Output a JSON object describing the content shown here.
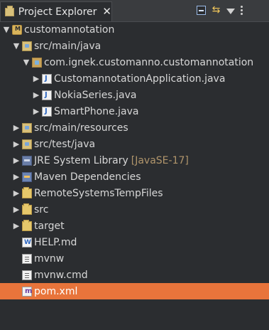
{
  "tab": {
    "title": "Project Explorer",
    "close": "✕"
  },
  "toolbar": {
    "collapse_all": "collapse-all",
    "link_with_editor": "link-with-editor",
    "filter": "filter",
    "view_menu": "view-menu"
  },
  "tree": {
    "items": [
      {
        "label": "customannotation",
        "icon": "project-icon",
        "expanded": true
      },
      {
        "label": "src/main/java",
        "icon": "source-folder-icon",
        "expanded": true
      },
      {
        "label": "com.ignek.customanno.customannotation",
        "icon": "package-icon",
        "expanded": true
      },
      {
        "label": "CustomannotationApplication.java",
        "icon": "java-class-icon",
        "expanded": false
      },
      {
        "label": "NokiaSeries.java",
        "icon": "java-interface-icon",
        "expanded": false
      },
      {
        "label": "SmartPhone.java",
        "icon": "java-class-icon",
        "expanded": false
      },
      {
        "label": "src/main/resources",
        "icon": "source-folder-icon",
        "expanded": false
      },
      {
        "label": "src/test/java",
        "icon": "source-folder-icon",
        "expanded": false
      },
      {
        "label": "JRE System Library",
        "extra": "[JavaSE-17]",
        "icon": "library-icon",
        "expanded": false
      },
      {
        "label": "Maven Dependencies",
        "icon": "maven-icon",
        "expanded": false
      },
      {
        "label": "RemoteSystemsTempFiles",
        "icon": "folder-icon",
        "expanded": false
      },
      {
        "label": "src",
        "icon": "folder-icon",
        "expanded": false
      },
      {
        "label": "target",
        "icon": "folder-icon",
        "expanded": false
      },
      {
        "label": "HELP.md",
        "icon": "markdown-file-icon"
      },
      {
        "label": "mvnw",
        "icon": "file-icon"
      },
      {
        "label": "mvnw.cmd",
        "icon": "file-icon"
      },
      {
        "label": "pom.xml",
        "icon": "maven-pom-icon",
        "selected": true
      }
    ]
  },
  "colors": {
    "background": "#2b2d30",
    "selection": "#e8743b",
    "text": "#d7d7d7",
    "extra": "#b0956b"
  }
}
